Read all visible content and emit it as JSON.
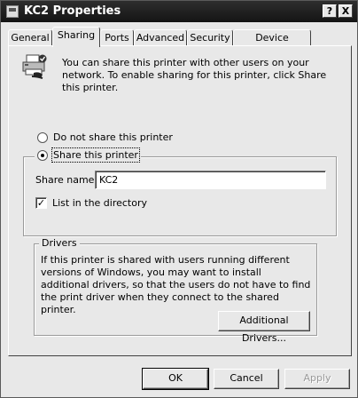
{
  "window": {
    "title": "KC2 Properties",
    "help_btn": "?",
    "close_btn": "X"
  },
  "tabs": [
    {
      "label": "General"
    },
    {
      "label": "Sharing"
    },
    {
      "label": "Ports"
    },
    {
      "label": "Advanced"
    },
    {
      "label": "Security"
    },
    {
      "label": "Device Settings"
    }
  ],
  "active_tab": "Sharing",
  "sharing": {
    "intro": "You can share this printer with other users on your network.  To enable sharing for this printer, click Share this printer.",
    "do_not_share_label": "Do not share this printer",
    "share_label": "Share this printer",
    "share_name_label": "Share name:",
    "share_name_value": "KC2",
    "list_directory_label": "List in the directory",
    "list_directory_checked": true
  },
  "drivers": {
    "legend": "Drivers",
    "text": "If this printer is shared with users running different versions of Windows, you may want to install additional drivers, so that the users do not have to find the print driver when they connect to the shared printer.",
    "button": "Additional Drivers..."
  },
  "footer": {
    "ok": "OK",
    "cancel": "Cancel",
    "apply": "Apply"
  }
}
